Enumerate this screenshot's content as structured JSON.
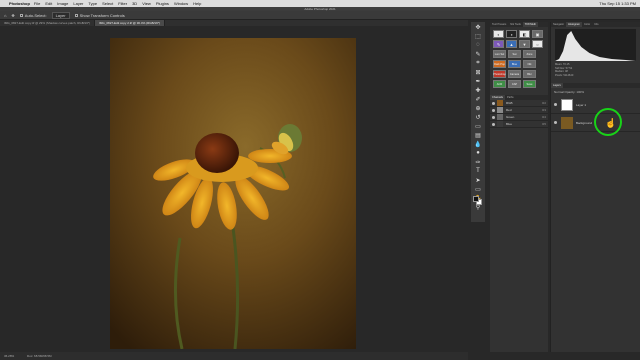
{
  "menubar": {
    "app_name": "Photoshop",
    "items": [
      "File",
      "Edit",
      "Image",
      "Layer",
      "Type",
      "Select",
      "Filter",
      "3D",
      "View",
      "Plugins",
      "Window",
      "Help"
    ],
    "clock": "Thu Sep 15 1:33 PM"
  },
  "window": {
    "title": "Adobe Photoshop 2021"
  },
  "options_bar": {
    "auto_select_label": "Auto-Select:",
    "auto_select_value": "Layer",
    "show_transform_label": "Show Transform Controls"
  },
  "doc_tabs": [
    {
      "label": "IMG_0827-Edit copy.tif @ 29% (Shadow curves patch, RGB/16*)"
    },
    {
      "label": "IMG_0827-Edit copy 2.tif @ 30.4% (RGB/16*)"
    }
  ],
  "status": {
    "zoom": "36.28%",
    "doc_size": "Doc: 68.5M/68.5M"
  },
  "mid_panel": {
    "tabs": [
      "Tool Presets",
      "Nik Tools",
      "TK8 Multi"
    ],
    "active_tab": "TK8 Multi",
    "button_labels": [
      "Lum Sel",
      "Sat",
      "Zone",
      "Dark Pop",
      "Blue",
      "Nik",
      "Photoshop",
      "Camera",
      "Blur",
      "ACR",
      "CAP",
      "Save"
    ],
    "channels_tabs": [
      "Channels",
      "Paths"
    ],
    "channels": [
      {
        "name": "RGB",
        "shortcut": "⌘2"
      },
      {
        "name": "Red",
        "shortcut": "⌘3"
      },
      {
        "name": "Green",
        "shortcut": "⌘4"
      },
      {
        "name": "Blue",
        "shortcut": "⌘5"
      }
    ]
  },
  "right_panel": {
    "tabs": [
      "Navigator",
      "Histogram",
      "Color",
      "Info"
    ],
    "active_tab": "Histogram",
    "histo_info": [
      "Mean: 70.15",
      "Std Dev: 57.52",
      "Median: 48",
      "Pixels: 5114640"
    ],
    "layers_tabs": [
      "Layers"
    ],
    "layers_tools": "Normal  Opacity: 100%",
    "layers": [
      {
        "name": "Layer 1"
      },
      {
        "name": "Background"
      }
    ]
  },
  "colors": {
    "highlight": "#18d318"
  }
}
